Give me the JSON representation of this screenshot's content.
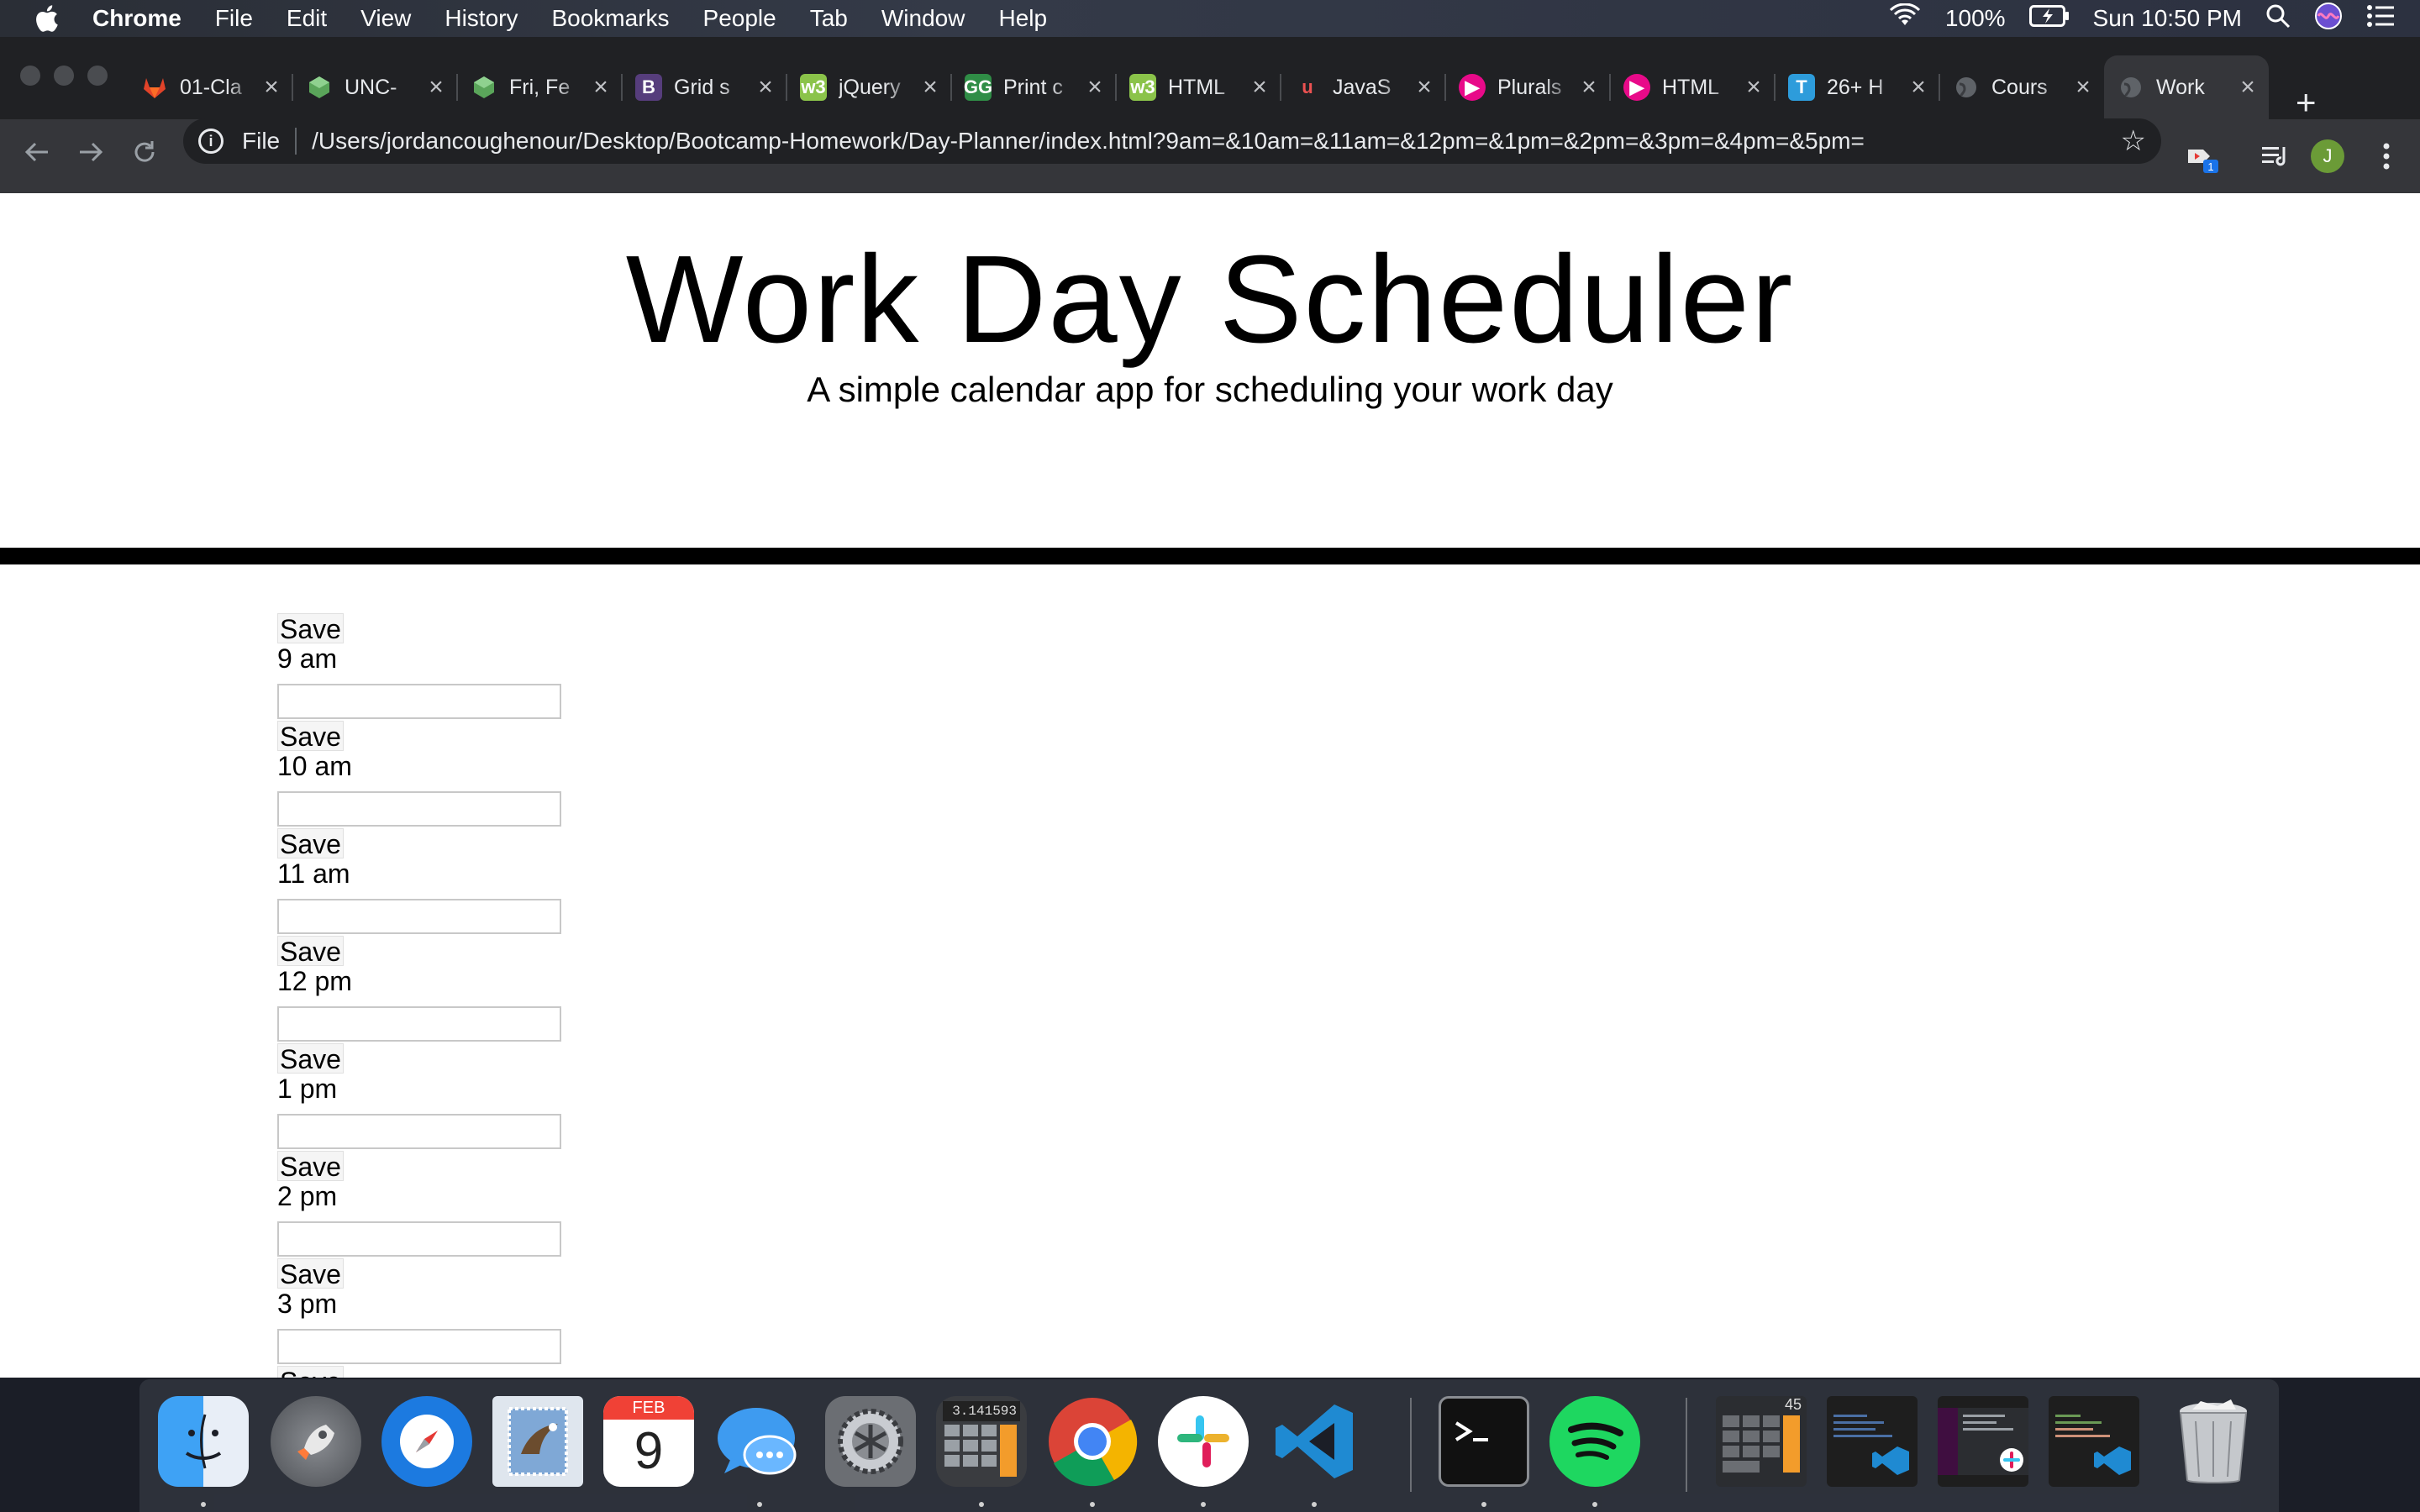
{
  "menubar": {
    "app_name": "Chrome",
    "items": [
      "File",
      "Edit",
      "View",
      "History",
      "Bookmarks",
      "People",
      "Tab",
      "Window",
      "Help"
    ],
    "battery": "100%",
    "clock": "Sun 10:50 PM"
  },
  "tabs": [
    {
      "title": "01-Cla",
      "icon": "gitlab-icon",
      "color": "#e24329"
    },
    {
      "title": "UNC-",
      "icon": "cube-icon",
      "color": "#5aa55a"
    },
    {
      "title": "Fri, Fe",
      "icon": "cube-icon",
      "color": "#5aa55a"
    },
    {
      "title": "Grid s",
      "icon": "bootstrap-icon",
      "color": "#563d7c",
      "glyph": "B"
    },
    {
      "title": "jQuery",
      "icon": "w3schools-icon",
      "color": "#8bc34a",
      "glyph": "w3"
    },
    {
      "title": "Print c",
      "icon": "geeksforgeeks-icon",
      "color": "#2f8d46",
      "glyph": "GG"
    },
    {
      "title": "HTML",
      "icon": "w3schools-icon",
      "color": "#8bc34a",
      "glyph": "w3"
    },
    {
      "title": "JavaS",
      "icon": "udemy-icon",
      "color": "#ec5252",
      "glyph": "u"
    },
    {
      "title": "Plurals",
      "icon": "pluralsight-icon",
      "color": "#e80a89",
      "glyph": "▶"
    },
    {
      "title": "HTML",
      "icon": "pluralsight-icon",
      "color": "#e80a89",
      "glyph": "▶"
    },
    {
      "title": "26+ H",
      "icon": "t-icon",
      "color": "#2d9cdb",
      "glyph": "T"
    },
    {
      "title": "Cours",
      "icon": "globe-icon",
      "color": "#5f6368"
    },
    {
      "title": "Work",
      "icon": "globe-icon",
      "color": "#5f6368"
    }
  ],
  "omnibox": {
    "scheme_label": "File",
    "url": "/Users/jordancoughenour/Desktop/Bootcamp-Homework/Day-Planner/index.html?9am=&10am=&11am=&12pm=&1pm=&2pm=&3pm=&4pm=&5pm="
  },
  "profile_initial": "J",
  "extension_badge": "1",
  "page": {
    "title": "Work Day Scheduler",
    "subtitle": "A simple calendar app for scheduling your work day",
    "save_label": "Save",
    "hours": [
      "9 am",
      "10 am",
      "11 am",
      "12 pm",
      "1 pm",
      "2 pm",
      "3 pm"
    ]
  },
  "dock": {
    "calendar_month": "FEB",
    "calendar_day": "9",
    "calculator_display": "3.141593",
    "mini_calc_display": "45"
  }
}
